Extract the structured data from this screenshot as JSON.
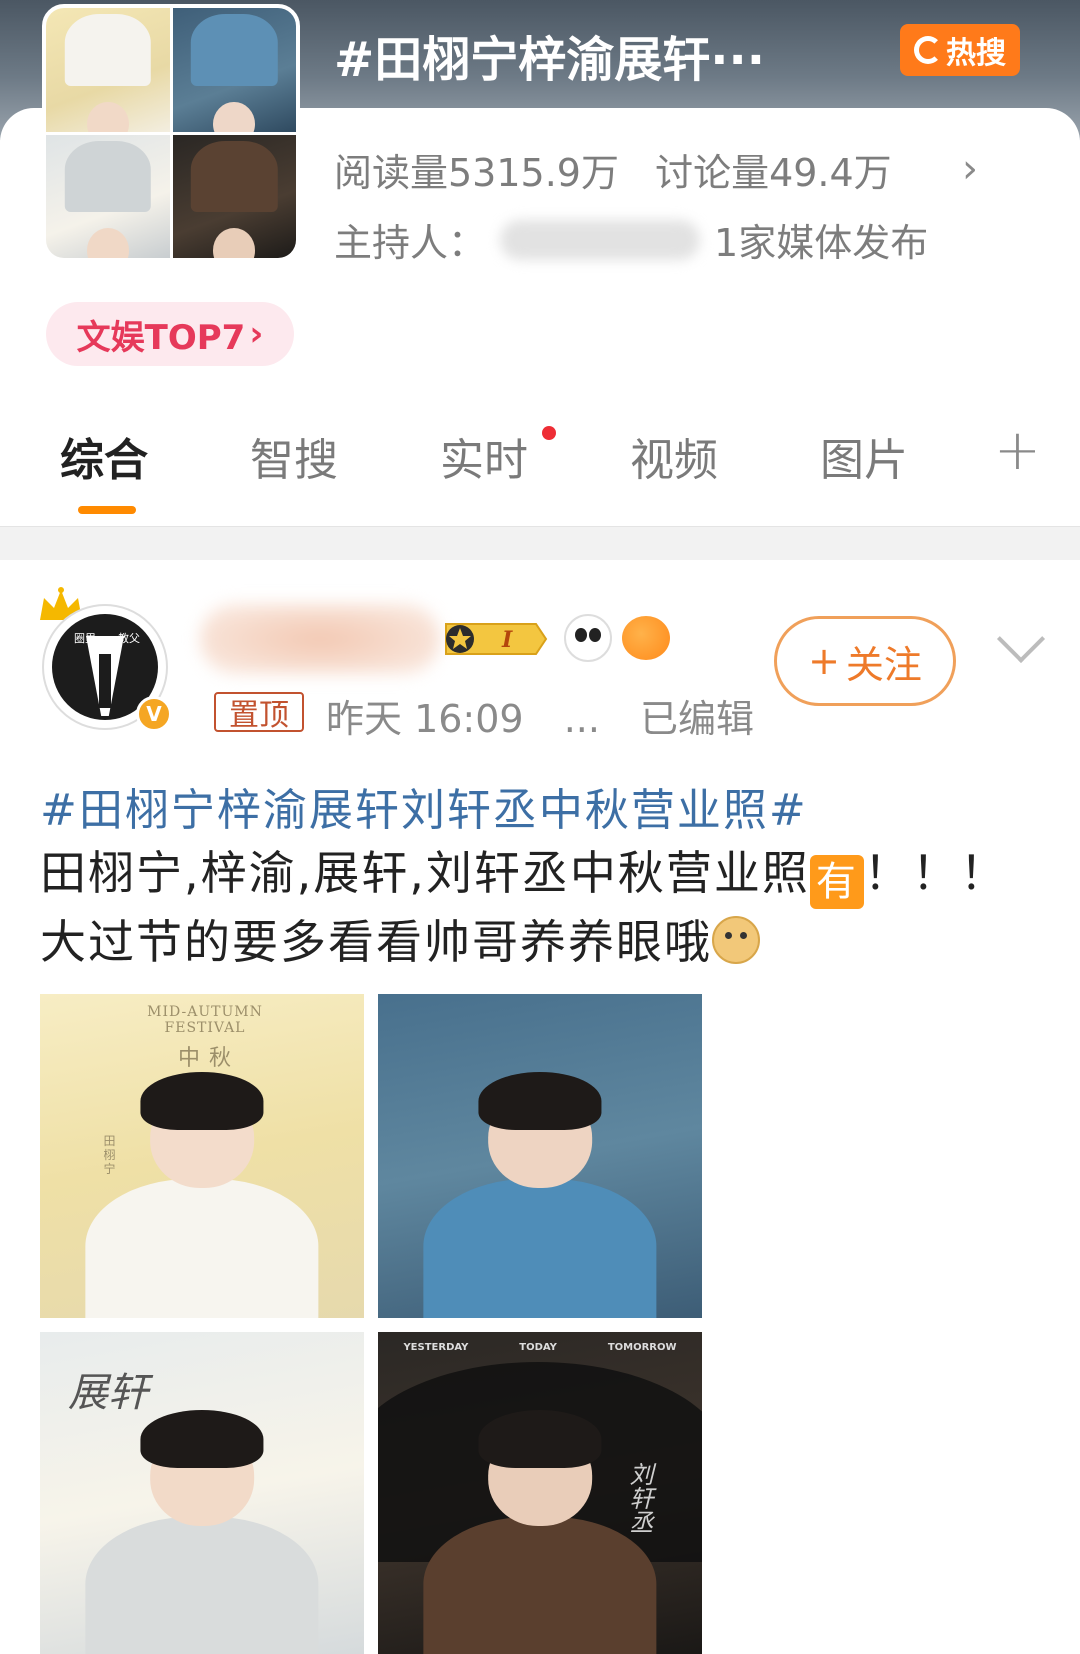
{
  "topic": {
    "title": "#田栩宁梓渝展轩···",
    "hot_badge": "热搜",
    "reads": "阅读量5315.9万",
    "discussions": "讨论量49.4万",
    "host_label": "主持人：",
    "media_count": "1家媒体发布",
    "rank_pill": "文娱TOP7",
    "accent_color": "#ff7a1a"
  },
  "tabs": [
    {
      "label": "综合",
      "active": true
    },
    {
      "label": "智搜",
      "active": false
    },
    {
      "label": "实时",
      "active": false,
      "has_dot": true
    },
    {
      "label": "视频",
      "active": false
    },
    {
      "label": "图片",
      "active": false
    }
  ],
  "post": {
    "pin_tag": "置顶",
    "time": "昨天 16:09",
    "more": "...",
    "edited": "已编辑",
    "follow_label": "关注",
    "avatar_text_left": "圈里",
    "avatar_text_right": "教父",
    "verified_mark": "V",
    "vip_mark": "I",
    "topic_link": "#田栩宁梓渝展轩刘轩丞中秋营业照#",
    "text_line1_prefix": "田栩宁,梓渝,展轩,刘轩丞中秋营业照",
    "emoji_you": "有",
    "text_line1_suffix": "！！！",
    "text_line2": "大过节的要多看看帅哥养养眼哦",
    "images": [
      {
        "caption_top": "MID-AUTUMN FESTIVAL",
        "caption_cn": "中 秋",
        "caption_side": "田栩宁"
      },
      {
        "caption_top": ""
      },
      {
        "signature": "展轩"
      },
      {
        "top_left": "YESTERDAY",
        "top_mid": "TODAY",
        "top_right": "TOMORROW",
        "signature": "刘轩丞"
      }
    ]
  }
}
